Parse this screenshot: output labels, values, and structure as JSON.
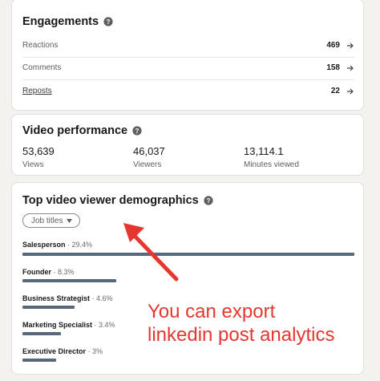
{
  "engagements": {
    "title": "Engagements",
    "rows": [
      {
        "label": "Reactions",
        "value": "469"
      },
      {
        "label": "Comments",
        "value": "158"
      },
      {
        "label": "Reposts",
        "value": "22"
      }
    ]
  },
  "video_performance": {
    "title": "Video performance",
    "metrics": [
      {
        "value": "53,639",
        "label": "Views"
      },
      {
        "value": "46,037",
        "label": "Viewers"
      },
      {
        "value": "13,114.1",
        "label": "Minutes viewed"
      }
    ]
  },
  "demographics": {
    "title": "Top video viewer demographics",
    "filter_label": "Job titles",
    "items": [
      {
        "title": "Salesperson",
        "percent_text": "· 29.4%",
        "percent": 29.4
      },
      {
        "title": "Founder",
        "percent_text": "· 8.3%",
        "percent": 8.3
      },
      {
        "title": "Business Strategist",
        "percent_text": "· 4.6%",
        "percent": 4.6
      },
      {
        "title": "Marketing Specialist",
        "percent_text": "· 3.4%",
        "percent": 3.4
      },
      {
        "title": "Executive Director",
        "percent_text": "· 3%",
        "percent": 3.0
      }
    ]
  },
  "annotation": {
    "line1": "You can export",
    "line2": "linkedin post analytics"
  },
  "colors": {
    "bar": "#56687a",
    "annotation": "#e5362f",
    "page_background": "#f4f2ee"
  },
  "icons": [
    "help-icon",
    "arrow-right-icon",
    "caret-down-icon"
  ]
}
